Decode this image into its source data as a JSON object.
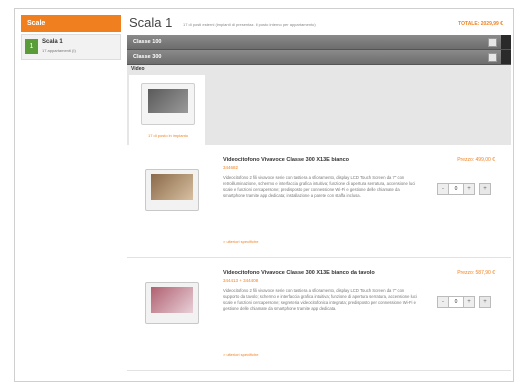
{
  "sidebar": {
    "header": "Scale",
    "items": [
      {
        "number": "1",
        "title": "Scala 1",
        "subtitle": "17 appartamenti (I)"
      }
    ]
  },
  "main": {
    "title": "Scala 1",
    "subtitle": "17 di posti esterni (impianti di presentaz. il posto interno per appartamento)",
    "total": "TOTALE: 2029,99 €",
    "bars": [
      {
        "label": "Classe 100"
      },
      {
        "label": "Classe 300"
      }
    ],
    "video": {
      "label": "Video",
      "caption": "17 di posto in impianto"
    },
    "products": [
      {
        "title": "Videocitofono Vivavoce Classe 300 X13E bianco",
        "code": "344682",
        "price": "Prezzo: 499,00 €",
        "description": "Videocitofono 2 fili vivavoce serie con tastiera a sfioramento, display LCD Touch Screen da 7\" con retroilluminazione, schermo e interfaccia grafica intuitiva; funzione di apertura serratura, accensione luci scale e funzioni cercapersone; predisposto per connessione Wi-Fi e gestione delle chiamate da smartphone tramite app dedicata; installazione a parete con staffa inclusa.",
        "link": "> ulteriori specifiche",
        "qty": "0",
        "qty_minus": "-",
        "qty_plus": "+",
        "add": "+"
      },
      {
        "title": "Videocitofono Vivavoce Classe 300 X13E bianco da tavolo",
        "code": "344413 + 344408",
        "price": "Prezzo: 587,90 €",
        "description": "Videocitofono 2 fili vivavoce serie con tastiera a sfioramento, display LCD Touch Screen da 7\" con supporto da tavolo; schermo e interfaccia grafica intuitiva; funzione di apertura serratura, accensione luci scale e funzioni cercapersone; segreteria videocitofonica integrata; predisposto per connessione Wi-Fi e gestione delle chiamate da smartphone tramite app dedicata.",
        "link": "> ulteriori specifiche",
        "qty": "0",
        "qty_minus": "-",
        "qty_plus": "+",
        "add": "+"
      }
    ]
  },
  "colors": {
    "accent": "#f0801f",
    "bar": "#7a7a7a",
    "badge": "#5b9c3a"
  }
}
